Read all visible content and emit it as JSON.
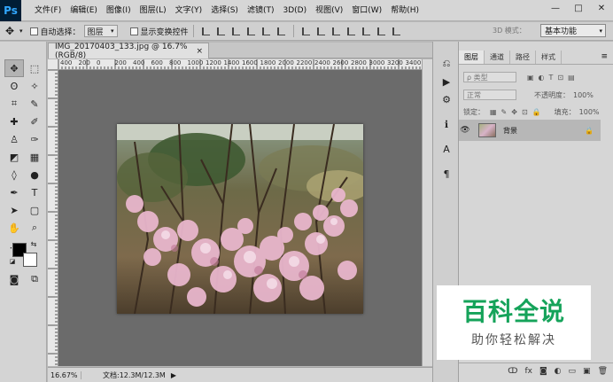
{
  "app": {
    "logo": "Ps",
    "menus": [
      "文件(F)",
      "编辑(E)",
      "图像(I)",
      "图层(L)",
      "文字(Y)",
      "选择(S)",
      "滤镜(T)",
      "3D(D)",
      "视图(V)",
      "窗口(W)",
      "帮助(H)"
    ],
    "window_controls": {
      "minimize": "—",
      "maximize": "□",
      "close": "✕"
    }
  },
  "options_bar": {
    "auto_select_label": "自动选择：",
    "auto_select_value": "图层",
    "show_transform_label": "显示变换控件",
    "mode_3d_label": "3D 模式：",
    "workspace": "基本功能"
  },
  "document": {
    "tab_title": "IMG_20170403_133.jpg @ 16.7%(RGB/8)",
    "tab_close": "×",
    "ruler_labels": [
      "400",
      "200",
      "0",
      "200",
      "400",
      "600",
      "800",
      "1000",
      "1200",
      "1400",
      "1600",
      "1800",
      "2000",
      "2200",
      "2400",
      "2600",
      "2800",
      "3000",
      "3200",
      "3400"
    ],
    "zoom": "16.67%",
    "doc_info": "文档:12.3M/12.3M",
    "status_arrow": "▶"
  },
  "layers_panel": {
    "tabs": [
      "图层",
      "通道",
      "路径",
      "样式"
    ],
    "menu_icon": "≡",
    "filter_type": "ρ 类型",
    "blend_mode": "正常",
    "opacity_label": "不透明度：",
    "opacity_value": "100%",
    "lock_label": "锁定：",
    "fill_label": "填充：",
    "fill_value": "100%",
    "layer": {
      "name": "背景",
      "visible_icon": "👁",
      "lock_icon": "🔒"
    },
    "bottom_icons": [
      "ↀ",
      "fx",
      "◙",
      "◐",
      "▭",
      "▣",
      "🗑"
    ]
  },
  "watermark": {
    "main": "百科全说",
    "sub": "助你轻松解决"
  },
  "colors": {
    "ps_blue": "#31a8ff",
    "ps_dark": "#001e36",
    "watermark_green": "#15a35a",
    "canvas_gray": "#6b6b6b"
  }
}
